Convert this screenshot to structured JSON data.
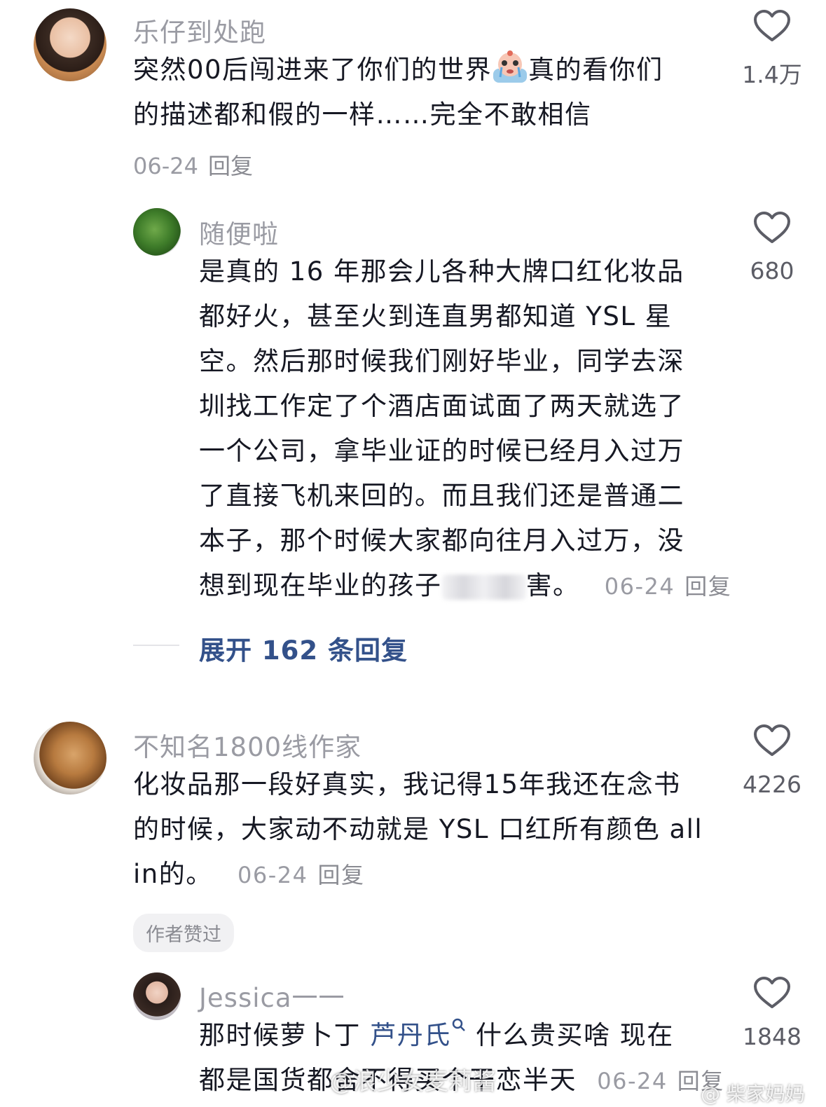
{
  "comments": [
    {
      "username": "乐仔到处跑",
      "text_a": "突然00后闯进来了你们的世界",
      "emoji": "crying-emoji",
      "text_b": "真的看你们",
      "text_line2": "的描述都和假的一样……完全不敢相信",
      "date": "06-24",
      "reply_label": "回复",
      "likes": "1.4万"
    },
    {
      "username": "随便啦",
      "lines": [
        "是真的 16 年那会儿各种大牌口红化妆品",
        "都好火，甚至火到连直男都知道 YSL 星",
        "空。然后那时候我们刚好毕业，同学去深",
        "圳找工作定了个酒店面试面了两天就选了",
        "一个公司，拿毕业证的时候已经月入过万",
        "了直接飞机来回的。而且我们还是普通二",
        "本子，那个时候大家都向往月入过万，没"
      ],
      "last_line_a": "想到现在毕业的孩子",
      "last_line_b": "害。",
      "date": "06-24",
      "reply_label": "回复",
      "likes": "680",
      "expand_label": "展开 162 条回复"
    },
    {
      "username": "不知名1800线作家",
      "lines": [
        "化妆品那一段好真实，我记得15年我还在念书",
        "的时候，大家动不动就是 YSL 口红所有颜色 all"
      ],
      "last_line": "in的。",
      "date": "06-24",
      "reply_label": "回复",
      "likes": "4226",
      "tag": "作者赞过"
    },
    {
      "username": "Jessica一一",
      "text_a": "那时候萝卜丁 ",
      "link": "芦丹氏",
      "text_b": " 什么贵买啥 现在",
      "line2": "都是国货都舍不得买个干恋半天",
      "date": "06-24",
      "reply_label": "回复",
      "likes": "1848"
    }
  ],
  "watermark": "@浪少女麦莉酱",
  "watermark_right": "@ 柴家妈妈",
  "icons": {
    "like": "heart-icon",
    "search": "search-icon"
  },
  "colors": {
    "link": "#33518a",
    "muted": "#9a9ba3",
    "text": "#161823"
  }
}
